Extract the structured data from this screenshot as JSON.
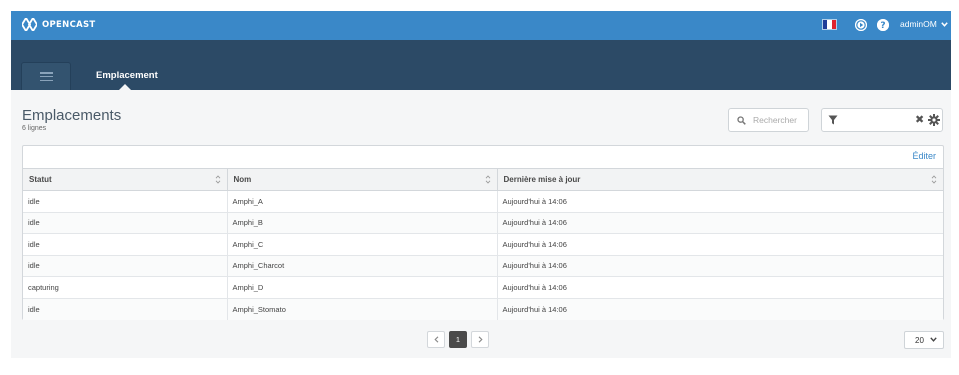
{
  "header": {
    "brand": "OPENCAST",
    "language_flag": "french-flag",
    "user_label": "adminOM",
    "colors": {
      "topbar": "#3a88c8",
      "navband": "#2c4a66",
      "accent": "#3a88c8"
    }
  },
  "nav": {
    "active_tab": "Emplacement"
  },
  "page": {
    "title": "Emplacements",
    "count": "6 lignes"
  },
  "search": {
    "placeholder": "Rechercher"
  },
  "table": {
    "edit_label": "Éditer",
    "columns": [
      "Statut",
      "Nom",
      "Dernière mise à jour"
    ],
    "rows": [
      [
        "idle",
        "Amphi_A",
        "Aujourd'hui à 14:06"
      ],
      [
        "idle",
        "Amphi_B",
        "Aujourd'hui à 14:06"
      ],
      [
        "idle",
        "Amphi_C",
        "Aujourd'hui à 14:06"
      ],
      [
        "idle",
        "Amphi_Charcot",
        "Aujourd'hui à 14:06"
      ],
      [
        "capturing",
        "Amphi_D",
        "Aujourd'hui à 14:06"
      ],
      [
        "idle",
        "Amphi_Stomato",
        "Aujourd'hui à 14:06"
      ]
    ]
  },
  "pagination": {
    "current_page": "1",
    "page_size": "20"
  }
}
